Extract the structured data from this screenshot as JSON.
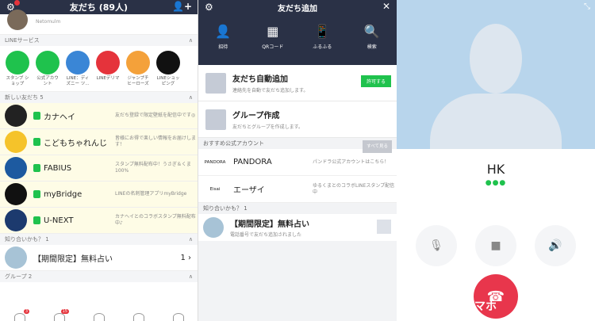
{
  "friends_panel": {
    "title": "友だち (89人)",
    "profile_sub": "Netomulm",
    "badge": "N",
    "section_services": "LINEサービス",
    "services": [
      {
        "label": "スタンプ ショップ",
        "color": "#1fc24d",
        "icon": "smile-icon"
      },
      {
        "label": "公式アカウ ント",
        "color": "#1fc24d",
        "icon": "shield-icon"
      },
      {
        "label": "LINE：ディ ズニー ツ...",
        "color": "#3a86d6",
        "icon": "disney-icon"
      },
      {
        "label": "LINEデリマ",
        "color": "#e5333b",
        "icon": "delima-icon"
      },
      {
        "label": "ジャンプチ ヒーローズ",
        "color": "#f4a13a",
        "icon": "jump-icon"
      },
      {
        "label": "LINEショッ ピング",
        "color": "#111111",
        "icon": "shopping-icon"
      }
    ],
    "section_new": "新しい友だち 5",
    "new_friends": [
      {
        "name": "カナヘイ",
        "desc": "友だち登録で限定壁紙を配信中です◎",
        "color": "#222222"
      },
      {
        "name": "こどもちゃれんじ",
        "desc": "皆様にお得で楽しい情報をお届けします！",
        "color": "#f5c32a"
      },
      {
        "name": "FABIUS",
        "desc": "スタンプ無料配布中！うさぎ＆くま100%",
        "color": "#1d5aa0"
      },
      {
        "name": "myBridge",
        "desc": "LINEの名刺管理アプリmyBridge",
        "color": "#111111"
      },
      {
        "name": "U-NEXT",
        "desc": "カナヘイとのコラボスタンプ無料配布中♪",
        "color": "#1c3a6e"
      }
    ],
    "section_maybe": "知り合いかも？ 1",
    "maybe_name": "【期間限定】無料占い",
    "maybe_arrow": "1 ›",
    "section_group": "グループ 2",
    "tab_badges": [
      "3",
      "15"
    ]
  },
  "add_panel": {
    "title": "友だち追加",
    "menu": [
      {
        "label": "招待",
        "icon": "invite-icon",
        "glyph": "👤"
      },
      {
        "label": "QRコード",
        "icon": "qr-icon",
        "glyph": "▦"
      },
      {
        "label": "ふるふる",
        "icon": "shake-icon",
        "glyph": "📱"
      },
      {
        "label": "検索",
        "icon": "search-icon",
        "glyph": "🔍"
      }
    ],
    "auto_add": {
      "title": "友だち自動追加",
      "desc": "連絡先を自動で友だち追加します。",
      "button": "許可する"
    },
    "group": {
      "title": "グループ作成",
      "desc": "友だちとグループを作成します。"
    },
    "section_official": "おすすめ公式アカウント",
    "see_all": "すべて見る",
    "officials": [
      {
        "logo": "PANDORA",
        "name": "PANDORA",
        "desc": "パンドラ公式アカウントはこちら！"
      },
      {
        "logo": "Eisai",
        "name": "エーザイ",
        "desc": "ゆるくまとのコラボLINEスタンプ配信中"
      }
    ],
    "section_maybe": "知り合いかも？ 1",
    "maybe_title": "【期間限定】無料占い",
    "maybe_desc": "電話番号で友だち追加されました"
  },
  "call_panel": {
    "name": "HK",
    "status_dots": "●●●",
    "watermark": "マホ"
  }
}
